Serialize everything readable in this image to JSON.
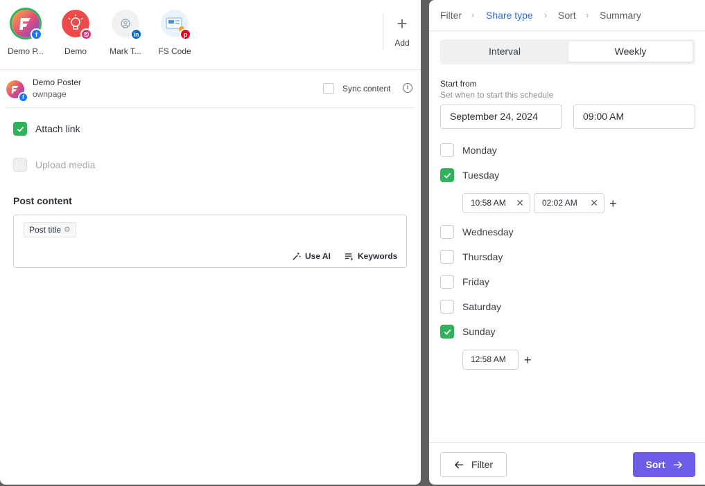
{
  "accounts": [
    {
      "name": "Demo P...",
      "network": "facebook-icon",
      "selected": true
    },
    {
      "name": "Demo",
      "network": "instagram-icon",
      "selected": false
    },
    {
      "name": "Mark T...",
      "network": "linkedin-icon",
      "selected": false
    },
    {
      "name": "FS Code",
      "network": "pinterest-icon",
      "selected": false
    }
  ],
  "add_label": "Add",
  "page": {
    "name": "Demo Poster",
    "sub": "ownpage",
    "sync_label": "Sync content",
    "sync_checked": false
  },
  "options": {
    "attach_link": {
      "label": "Attach link",
      "checked": true
    },
    "upload_media": {
      "label": "Upload media",
      "checked": false,
      "disabled": true
    }
  },
  "post_content": {
    "title": "Post content",
    "tag": "Post title",
    "use_ai": "Use AI",
    "keywords": "Keywords"
  },
  "breadcrumbs": [
    {
      "label": "Filter",
      "active": false
    },
    {
      "label": "Share type",
      "active": true
    },
    {
      "label": "Sort",
      "active": false
    },
    {
      "label": "Summary",
      "active": false
    }
  ],
  "segment": {
    "options": [
      "Interval",
      "Weekly"
    ],
    "selected": "Weekly"
  },
  "start": {
    "label": "Start from",
    "help": "Set when to start this schedule",
    "date": "September 24, 2024",
    "time": "09:00  AM"
  },
  "days": [
    {
      "label": "Monday",
      "checked": false,
      "times": []
    },
    {
      "label": "Tuesday",
      "checked": true,
      "times": [
        "10:58  AM",
        "02:02  AM"
      ]
    },
    {
      "label": "Wednesday",
      "checked": false,
      "times": []
    },
    {
      "label": "Thursday",
      "checked": false,
      "times": []
    },
    {
      "label": "Friday",
      "checked": false,
      "times": []
    },
    {
      "label": "Saturday",
      "checked": false,
      "times": []
    },
    {
      "label": "Sunday",
      "checked": true,
      "times": [
        "12:58  AM"
      ]
    }
  ],
  "footer": {
    "back_label": "Filter",
    "next_label": "Sort"
  },
  "colors": {
    "accent": "#6c5ce7",
    "check": "#2fb25a",
    "link": "#2f6fdb"
  }
}
